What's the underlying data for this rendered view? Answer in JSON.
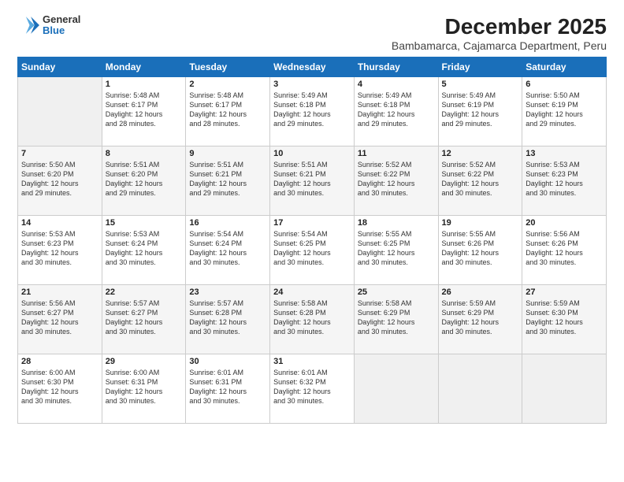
{
  "logo": {
    "general": "General",
    "blue": "Blue"
  },
  "title": "December 2025",
  "subtitle": "Bambamarca, Cajamarca Department, Peru",
  "days_of_week": [
    "Sunday",
    "Monday",
    "Tuesday",
    "Wednesday",
    "Thursday",
    "Friday",
    "Saturday"
  ],
  "weeks": [
    [
      {
        "day": "",
        "info": ""
      },
      {
        "day": "1",
        "info": "Sunrise: 5:48 AM\nSunset: 6:17 PM\nDaylight: 12 hours\nand 28 minutes."
      },
      {
        "day": "2",
        "info": "Sunrise: 5:48 AM\nSunset: 6:17 PM\nDaylight: 12 hours\nand 28 minutes."
      },
      {
        "day": "3",
        "info": "Sunrise: 5:49 AM\nSunset: 6:18 PM\nDaylight: 12 hours\nand 29 minutes."
      },
      {
        "day": "4",
        "info": "Sunrise: 5:49 AM\nSunset: 6:18 PM\nDaylight: 12 hours\nand 29 minutes."
      },
      {
        "day": "5",
        "info": "Sunrise: 5:49 AM\nSunset: 6:19 PM\nDaylight: 12 hours\nand 29 minutes."
      },
      {
        "day": "6",
        "info": "Sunrise: 5:50 AM\nSunset: 6:19 PM\nDaylight: 12 hours\nand 29 minutes."
      }
    ],
    [
      {
        "day": "7",
        "info": "Sunrise: 5:50 AM\nSunset: 6:20 PM\nDaylight: 12 hours\nand 29 minutes."
      },
      {
        "day": "8",
        "info": "Sunrise: 5:51 AM\nSunset: 6:20 PM\nDaylight: 12 hours\nand 29 minutes."
      },
      {
        "day": "9",
        "info": "Sunrise: 5:51 AM\nSunset: 6:21 PM\nDaylight: 12 hours\nand 29 minutes."
      },
      {
        "day": "10",
        "info": "Sunrise: 5:51 AM\nSunset: 6:21 PM\nDaylight: 12 hours\nand 30 minutes."
      },
      {
        "day": "11",
        "info": "Sunrise: 5:52 AM\nSunset: 6:22 PM\nDaylight: 12 hours\nand 30 minutes."
      },
      {
        "day": "12",
        "info": "Sunrise: 5:52 AM\nSunset: 6:22 PM\nDaylight: 12 hours\nand 30 minutes."
      },
      {
        "day": "13",
        "info": "Sunrise: 5:53 AM\nSunset: 6:23 PM\nDaylight: 12 hours\nand 30 minutes."
      }
    ],
    [
      {
        "day": "14",
        "info": "Sunrise: 5:53 AM\nSunset: 6:23 PM\nDaylight: 12 hours\nand 30 minutes."
      },
      {
        "day": "15",
        "info": "Sunrise: 5:53 AM\nSunset: 6:24 PM\nDaylight: 12 hours\nand 30 minutes."
      },
      {
        "day": "16",
        "info": "Sunrise: 5:54 AM\nSunset: 6:24 PM\nDaylight: 12 hours\nand 30 minutes."
      },
      {
        "day": "17",
        "info": "Sunrise: 5:54 AM\nSunset: 6:25 PM\nDaylight: 12 hours\nand 30 minutes."
      },
      {
        "day": "18",
        "info": "Sunrise: 5:55 AM\nSunset: 6:25 PM\nDaylight: 12 hours\nand 30 minutes."
      },
      {
        "day": "19",
        "info": "Sunrise: 5:55 AM\nSunset: 6:26 PM\nDaylight: 12 hours\nand 30 minutes."
      },
      {
        "day": "20",
        "info": "Sunrise: 5:56 AM\nSunset: 6:26 PM\nDaylight: 12 hours\nand 30 minutes."
      }
    ],
    [
      {
        "day": "21",
        "info": "Sunrise: 5:56 AM\nSunset: 6:27 PM\nDaylight: 12 hours\nand 30 minutes."
      },
      {
        "day": "22",
        "info": "Sunrise: 5:57 AM\nSunset: 6:27 PM\nDaylight: 12 hours\nand 30 minutes."
      },
      {
        "day": "23",
        "info": "Sunrise: 5:57 AM\nSunset: 6:28 PM\nDaylight: 12 hours\nand 30 minutes."
      },
      {
        "day": "24",
        "info": "Sunrise: 5:58 AM\nSunset: 6:28 PM\nDaylight: 12 hours\nand 30 minutes."
      },
      {
        "day": "25",
        "info": "Sunrise: 5:58 AM\nSunset: 6:29 PM\nDaylight: 12 hours\nand 30 minutes."
      },
      {
        "day": "26",
        "info": "Sunrise: 5:59 AM\nSunset: 6:29 PM\nDaylight: 12 hours\nand 30 minutes."
      },
      {
        "day": "27",
        "info": "Sunrise: 5:59 AM\nSunset: 6:30 PM\nDaylight: 12 hours\nand 30 minutes."
      }
    ],
    [
      {
        "day": "28",
        "info": "Sunrise: 6:00 AM\nSunset: 6:30 PM\nDaylight: 12 hours\nand 30 minutes."
      },
      {
        "day": "29",
        "info": "Sunrise: 6:00 AM\nSunset: 6:31 PM\nDaylight: 12 hours\nand 30 minutes."
      },
      {
        "day": "30",
        "info": "Sunrise: 6:01 AM\nSunset: 6:31 PM\nDaylight: 12 hours\nand 30 minutes."
      },
      {
        "day": "31",
        "info": "Sunrise: 6:01 AM\nSunset: 6:32 PM\nDaylight: 12 hours\nand 30 minutes."
      },
      {
        "day": "",
        "info": ""
      },
      {
        "day": "",
        "info": ""
      },
      {
        "day": "",
        "info": ""
      }
    ]
  ]
}
